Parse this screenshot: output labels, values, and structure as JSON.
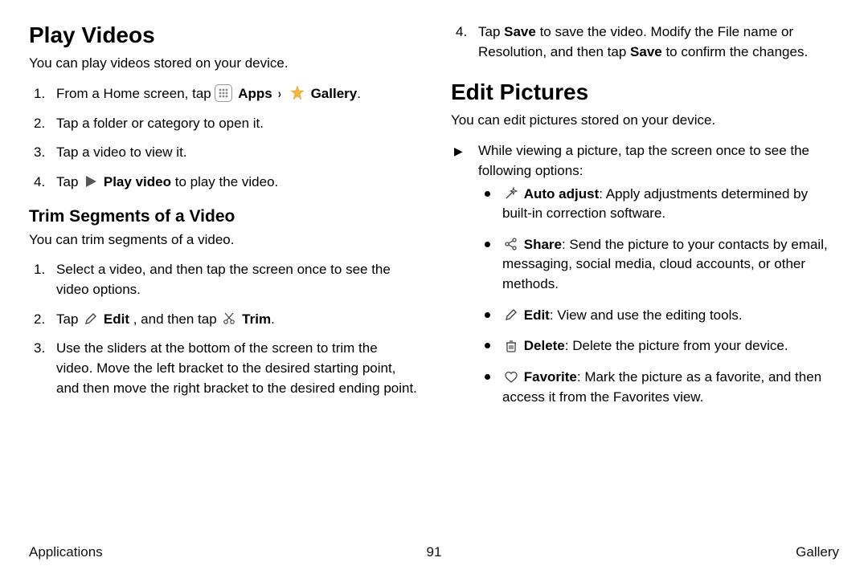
{
  "left": {
    "h1": "Play Videos",
    "intro": "You can play videos stored on your device.",
    "steps": {
      "s1_a": "From a Home screen, tap ",
      "s1_apps": "Apps",
      "s1_gallery": "Gallery",
      "s1_end": ".",
      "s2": "Tap a folder or category to open it.",
      "s3": "Tap a video to view it.",
      "s4_a": "Tap ",
      "s4_label": "Play video",
      "s4_b": " to play the video."
    },
    "h2": "Trim Segments of a Video",
    "trim_intro": "You can trim segments of a video.",
    "trim": {
      "t1": "Select a video, and then tap the screen once to see the video options.",
      "t2_a": "Tap ",
      "t2_edit": "Edit",
      "t2_mid": ", and then tap ",
      "t2_trim": "Trim",
      "t2_end": ".",
      "t3": "Use the sliders at the bottom of the screen to trim the video. Move the left bracket to the desired starting point, and then move the right bracket to the desired ending point."
    }
  },
  "right": {
    "carry": {
      "a": "Tap ",
      "save1": "Save",
      "b": " to save the video. Modify the File name or Resolution, and then tap ",
      "save2": "Save",
      "c": " to confirm the changes."
    },
    "h1": "Edit Pictures",
    "intro": "You can edit pictures stored on your device.",
    "arrow": "While viewing a picture, tap the screen once to see the following options:",
    "opts": {
      "auto_label": "Auto adjust",
      "auto_rest": ": Apply adjustments determined by built-in correction software.",
      "share_label": "Share",
      "share_rest": ": Send the picture to your contacts by email, messaging, social media, cloud accounts, or other methods.",
      "edit_label": "Edit",
      "edit_rest": ": View and use the editing tools.",
      "delete_label": "Delete",
      "delete_rest": ": Delete the picture from your device.",
      "fav_label": "Favorite",
      "fav_rest": ": Mark the picture as a favorite, and then access it from the Favorites view."
    }
  },
  "footer": {
    "left": "Applications",
    "center": "91",
    "right": "Gallery"
  }
}
